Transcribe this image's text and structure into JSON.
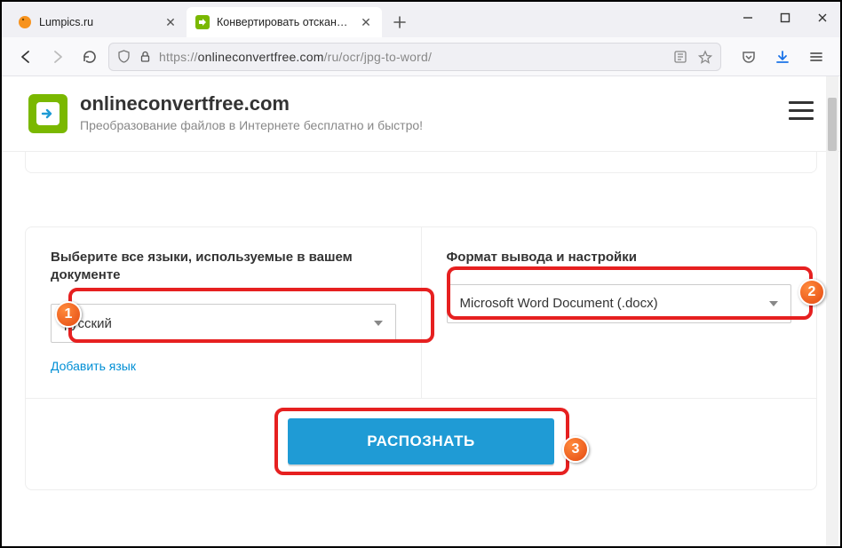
{
  "tabs": [
    {
      "title": "Lumpics.ru",
      "active": false,
      "favicon": "orange"
    },
    {
      "title": "Конвертировать отсканирован",
      "active": true,
      "favicon": "ocf"
    }
  ],
  "toolbar": {
    "url_prefix": "https://",
    "url_host": "onlineconvertfree.com",
    "url_path": "/ru/ocr/jpg-to-word/"
  },
  "header": {
    "site_name": "onlineconvertfree.com",
    "tagline": "Преобразование файлов в Интернете бесплатно и быстро!"
  },
  "form": {
    "lang_label": "Выберите все языки, используемые в вашем документе",
    "lang_value": "русский",
    "add_lang": "Добавить язык",
    "format_label": "Формат вывода и настройки",
    "format_value": "Microsoft Word Document (.docx)",
    "submit": "РАСПОЗНАТЬ"
  },
  "callouts": {
    "c1": "1",
    "c2": "2",
    "c3": "3"
  }
}
